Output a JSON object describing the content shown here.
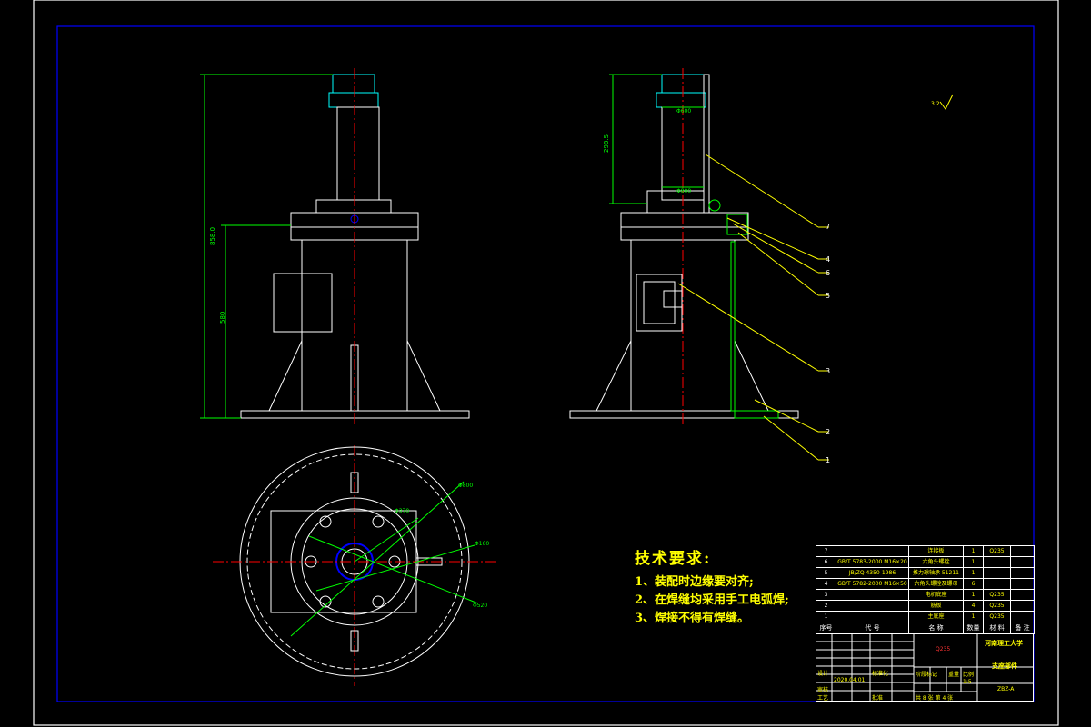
{
  "colors": {
    "background": "#000000",
    "frame": "#ffffff",
    "inner_frame": "#0000ff",
    "outline": "#ffffff",
    "center_line": "#ff0000",
    "dimension": "#00ff00",
    "leader": "#ffff00",
    "cyan_part": "#00ffff",
    "text": "#ffff00"
  },
  "surface_finish_label": "3.2",
  "tech_requirements": {
    "title": "技术要求:",
    "items": [
      "1、装配时边缘要对齐;",
      "2、在焊缝均采用手工电弧焊;",
      "3、焊接不得有焊缝。"
    ]
  },
  "balloons": [
    "7",
    "4",
    "6",
    "5",
    "3",
    "2",
    "1"
  ],
  "dimensions": {
    "front_total_height": "858.0",
    "front_partial_height": "580",
    "side_upper_height": "298.5",
    "side_top_width": "Φ600",
    "side_mid_width": "Φ800",
    "plan_radius_1": "Φ800",
    "plan_radius_2": "Φ520",
    "plan_radius_3": "Φ370",
    "plan_radius_4": "Φ160"
  },
  "bom": {
    "rows": [
      {
        "no": "7",
        "code": "",
        "name": "连接板",
        "qty": "1",
        "material": "Q235"
      },
      {
        "no": "6",
        "code": "GB/T 5783-2000 M16×20",
        "name": "六角头螺栓",
        "qty": "1",
        "material": ""
      },
      {
        "no": "5",
        "code": "JB/ZQ 4350-1986",
        "name": "推力球轴承 51211",
        "qty": "1",
        "material": ""
      },
      {
        "no": "4",
        "code": "GB/T 5782-2000 M16×50",
        "name": "六角头螺栓及螺母",
        "qty": "6",
        "material": ""
      },
      {
        "no": "3",
        "code": "",
        "name": "电机底座",
        "qty": "1",
        "material": "Q235"
      },
      {
        "no": "2",
        "code": "",
        "name": "筋板",
        "qty": "4",
        "material": "Q235"
      },
      {
        "no": "1",
        "code": "",
        "name": "主底座",
        "qty": "1",
        "material": "Q235"
      }
    ],
    "header": {
      "no": "序号",
      "code": "代 号",
      "name": "名 称",
      "qty": "数量",
      "material": "材 料",
      "note": "备 注"
    }
  },
  "title_block": {
    "university": "河南理工大学",
    "drawing_name": "支座部件",
    "drawing_no": "ZBZ-A",
    "material_mark": "Q235",
    "scale_label": "比例",
    "weight_label": "重量",
    "stage_label": "阶段标记",
    "scale_value": "1:5",
    "sheet_info": "共 8 张   第 4 张",
    "designer_label": "设计",
    "review_label": "审核",
    "process_label": "工艺",
    "standard_label": "标准化",
    "approve_label": "批准",
    "date_value": "2020.04.01"
  }
}
